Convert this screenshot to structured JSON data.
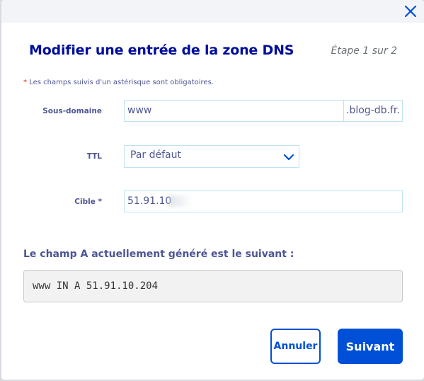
{
  "modal": {
    "title": "Modifier une entrée de la zone DNS",
    "step": "Étape 1 sur 2",
    "required_note_star": "*",
    "required_note": "Les champs suivis d'un astérisque sont obligatoires."
  },
  "form": {
    "subdomain_label": "Sous-domaine",
    "subdomain_value": "www",
    "domain_suffix": ".blog-db.fr.",
    "ttl_label": "TTL",
    "ttl_value": "Par défaut",
    "target_label": "Cible *",
    "target_value": "51.91.10"
  },
  "preview": {
    "title": "Le champ A actuellement généré est le suivant :",
    "record": "www IN A 51.91.10.204"
  },
  "buttons": {
    "cancel": "Annuler",
    "next": "Suivant"
  },
  "colors": {
    "primary": "#0050d7",
    "title": "#000e9c",
    "label": "#4d5693",
    "input_border": "#bfe3f2"
  }
}
